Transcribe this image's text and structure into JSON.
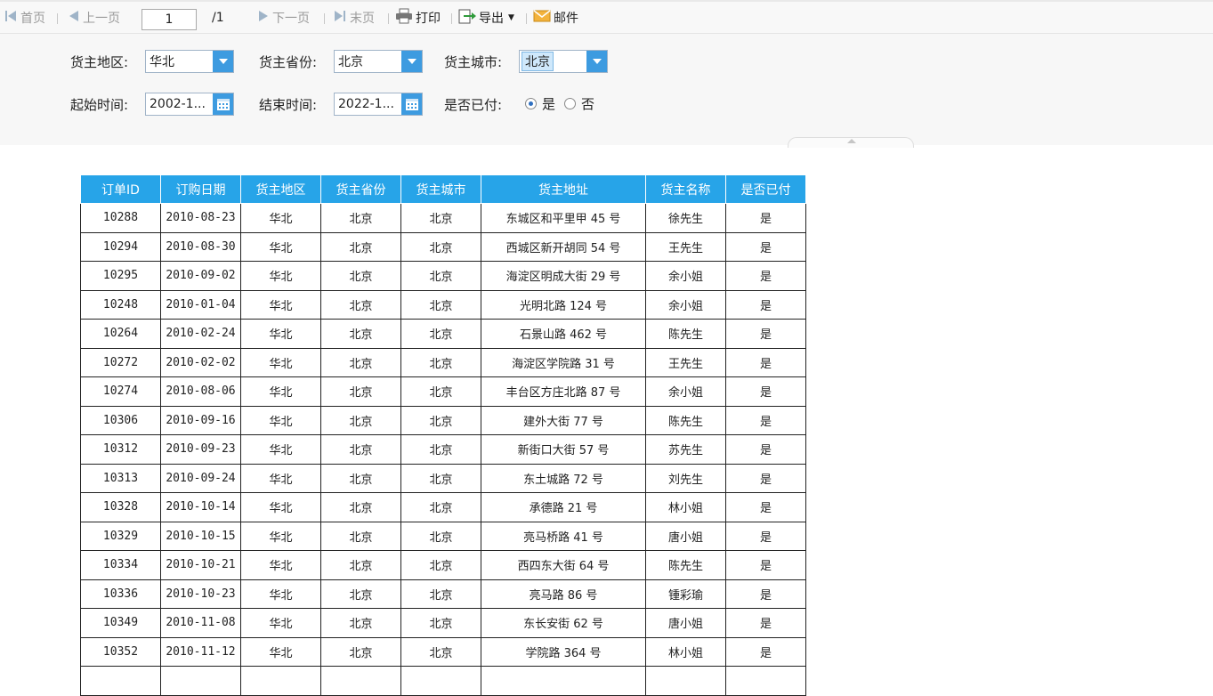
{
  "toolbar": {
    "first_label": "首页",
    "prev_label": "上一页",
    "page_value": "1",
    "page_total": "/1",
    "next_label": "下一页",
    "last_label": "末页",
    "print_label": "打印",
    "export_label": "导出",
    "mail_label": "邮件"
  },
  "params": {
    "region_label": "货主地区:",
    "region_value": "华北",
    "province_label": "货主省份:",
    "province_value": "北京",
    "city_label": "货主城市:",
    "city_value": "北京",
    "start_label": "起始时间:",
    "start_value": "2002-1...",
    "end_label": "结束时间:",
    "end_value": "2022-1...",
    "paid_label": "是否已付:",
    "paid_yes": "是",
    "paid_no": "否"
  },
  "table": {
    "headers": [
      "订单ID",
      "订购日期",
      "货主地区",
      "货主省份",
      "货主城市",
      "货主地址",
      "货主名称",
      "是否已付"
    ],
    "rows": [
      [
        "10288",
        "2010-08-23",
        "华北",
        "北京",
        "北京",
        "东城区和平里甲 45 号",
        "徐先生",
        "是"
      ],
      [
        "10294",
        "2010-08-30",
        "华北",
        "北京",
        "北京",
        "西城区新开胡同 54 号",
        "王先生",
        "是"
      ],
      [
        "10295",
        "2010-09-02",
        "华北",
        "北京",
        "北京",
        "海淀区明成大街 29 号",
        "余小姐",
        "是"
      ],
      [
        "10248",
        "2010-01-04",
        "华北",
        "北京",
        "北京",
        "光明北路 124 号",
        "余小姐",
        "是"
      ],
      [
        "10264",
        "2010-02-24",
        "华北",
        "北京",
        "北京",
        "石景山路 462 号",
        "陈先生",
        "是"
      ],
      [
        "10272",
        "2010-02-02",
        "华北",
        "北京",
        "北京",
        "海淀区学院路 31 号",
        "王先生",
        "是"
      ],
      [
        "10274",
        "2010-08-06",
        "华北",
        "北京",
        "北京",
        "丰台区方庄北路 87 号",
        "余小姐",
        "是"
      ],
      [
        "10306",
        "2010-09-16",
        "华北",
        "北京",
        "北京",
        "建外大街 77 号",
        "陈先生",
        "是"
      ],
      [
        "10312",
        "2010-09-23",
        "华北",
        "北京",
        "北京",
        "新街口大街 57 号",
        "苏先生",
        "是"
      ],
      [
        "10313",
        "2010-09-24",
        "华北",
        "北京",
        "北京",
        "东土城路 72 号",
        "刘先生",
        "是"
      ],
      [
        "10328",
        "2010-10-14",
        "华北",
        "北京",
        "北京",
        "承德路 21 号",
        "林小姐",
        "是"
      ],
      [
        "10329",
        "2010-10-15",
        "华北",
        "北京",
        "北京",
        "亮马桥路 41 号",
        "唐小姐",
        "是"
      ],
      [
        "10334",
        "2010-10-21",
        "华北",
        "北京",
        "北京",
        "西四东大街 64 号",
        "陈先生",
        "是"
      ],
      [
        "10336",
        "2010-10-23",
        "华北",
        "北京",
        "北京",
        "亮马路 86 号",
        "锺彩瑜",
        "是"
      ],
      [
        "10349",
        "2010-11-08",
        "华北",
        "北京",
        "北京",
        "东长安街 62 号",
        "唐小姐",
        "是"
      ],
      [
        "10352",
        "2010-11-12",
        "华北",
        "北京",
        "北京",
        "学院路 364 号",
        "林小姐",
        "是"
      ],
      [
        "",
        "",
        "",
        "",
        "",
        "",
        "",
        ""
      ]
    ]
  },
  "colors": {
    "header_bg": "#27a4e8",
    "combo_button": "#3d9be0"
  }
}
